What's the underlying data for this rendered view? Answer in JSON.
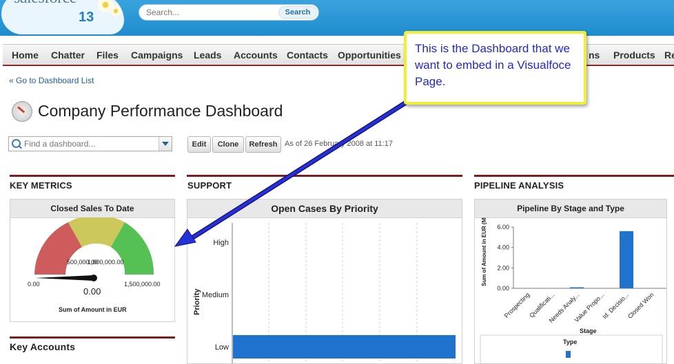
{
  "header": {
    "logo_text": "salesforce",
    "logo_version": "13",
    "search_placeholder": "Search...",
    "search_button": "Search"
  },
  "tabs": [
    {
      "label": "Home"
    },
    {
      "label": "Chatter"
    },
    {
      "label": "Files"
    },
    {
      "label": "Campaigns"
    },
    {
      "label": "Leads"
    },
    {
      "label": "Accounts"
    },
    {
      "label": "Contacts"
    },
    {
      "label": "Opportunities"
    },
    {
      "label": "ns"
    },
    {
      "label": "Products"
    },
    {
      "label": "Re"
    }
  ],
  "page": {
    "back_link": "« Go to Dashboard List",
    "title": "Company Performance Dashboard",
    "finder_placeholder": "Find a dashboard...",
    "buttons": {
      "edit": "Edit",
      "clone": "Clone",
      "refresh": "Refresh"
    },
    "as_of": "As of 26 February 2008 at 11:17"
  },
  "columns": {
    "key_metrics": "KEY METRICS",
    "support": "SUPPORT",
    "pipeline": "PIPELINE ANALYSIS",
    "key_accounts": "Key Accounts"
  },
  "gauge": {
    "title": "Closed Sales To Date",
    "min_label": "0.00",
    "mid_label": "500,000.00",
    "mid2_label": "1,000,000.00",
    "max_label": "1,500,000.00",
    "value_label": "0.00",
    "footer": "Sum of Amount in EUR",
    "colors": {
      "low": "#cf5c5c",
      "mid": "#cdc85c",
      "high": "#55c155"
    }
  },
  "chart_data": [
    {
      "type": "bar",
      "title": "Open Cases By Priority",
      "ylabel": "Priority",
      "categories": [
        "High",
        "Medium",
        "Low"
      ],
      "orientation": "horizontal",
      "values": [
        0,
        0,
        1
      ],
      "color": "#1f73cf"
    },
    {
      "type": "bar",
      "title": "Pipeline By Stage and Type",
      "ylabel": "Sum of Amount in EUR (Millions)",
      "xlabel": "Stage",
      "categories": [
        "Prospecting",
        "Qualificati...",
        "Needs Analy...",
        "Value Propo...",
        "Id. Decisio...",
        "Closed Won"
      ],
      "values": [
        0,
        0,
        0.1,
        0,
        5.6,
        0
      ],
      "yticks": [
        "6.00",
        "4.00",
        "2.00",
        "0.00"
      ],
      "ylim": [
        0,
        6
      ],
      "legend_title": "Type",
      "color": "#1f73cf"
    }
  ],
  "callout": {
    "text": "This is the Dashboard that we want to embed in a Visualfoce Page."
  }
}
